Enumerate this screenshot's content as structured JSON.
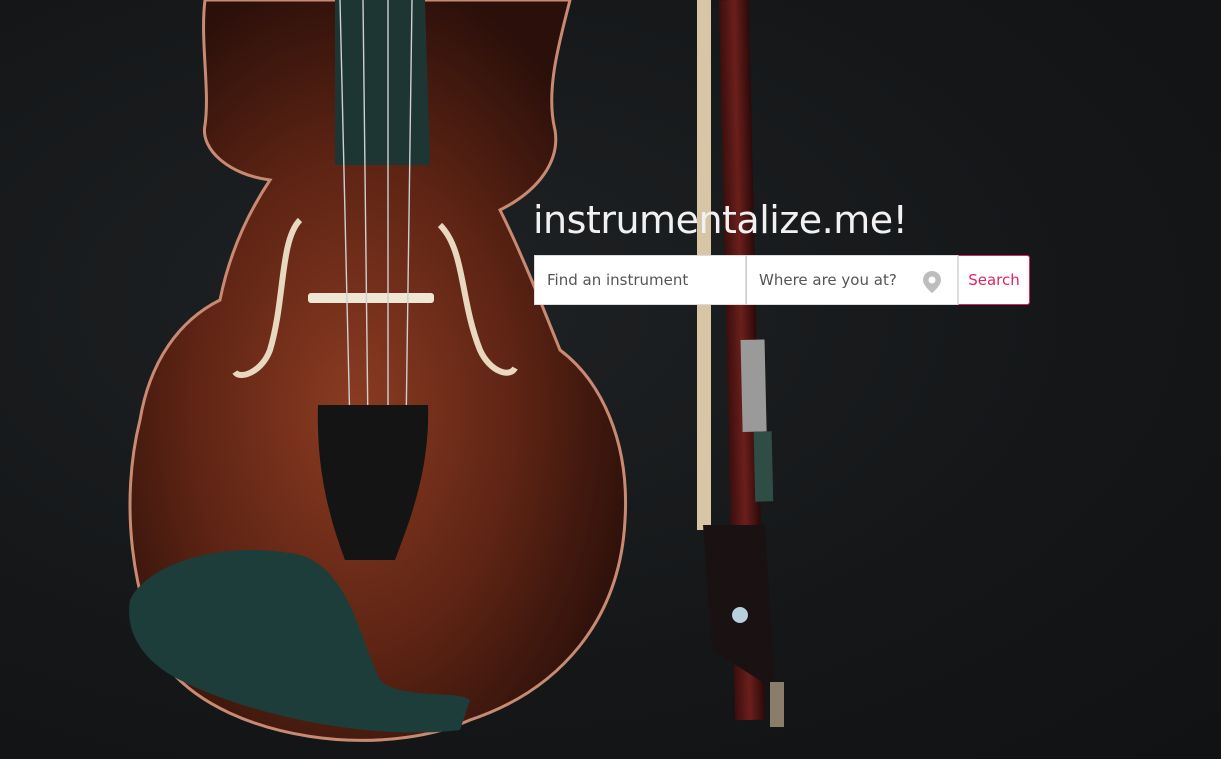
{
  "brand": {
    "title": "instrumentalize.me!"
  },
  "search": {
    "instrument_placeholder": "Find an instrument",
    "location_placeholder": "Where are you at?",
    "location_icon": "map-pin-icon",
    "button_label": "Search"
  },
  "colors": {
    "accent": "#e0245e",
    "background": "#151719",
    "title": "#f1f1f1"
  }
}
